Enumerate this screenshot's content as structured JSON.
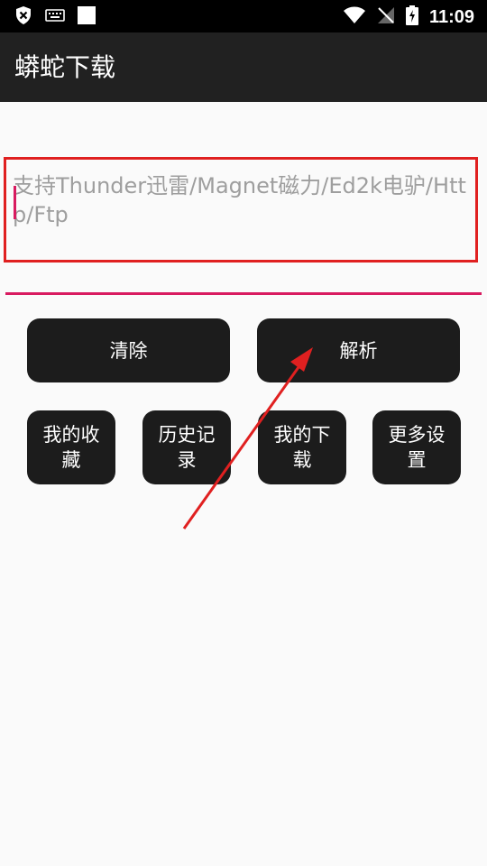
{
  "status_bar": {
    "time": "11:09",
    "icons": [
      "shield-x-icon",
      "keyboard-icon",
      "square-icon",
      "wifi-icon",
      "no-signal-icon",
      "battery-charging-icon"
    ]
  },
  "app_bar": {
    "title": "蟒蛇下载"
  },
  "link_input": {
    "placeholder": "支持Thunder迅雷/Magnet磁力/Ed2k电驴/Http/Ftp",
    "value": ""
  },
  "buttons": {
    "clear": "清除",
    "parse": "解析",
    "favorites": "我的收藏",
    "history": "历史记录",
    "downloads": "我的下载",
    "more_settings": "更多设置"
  },
  "annotation": {
    "color": "#e02020"
  }
}
